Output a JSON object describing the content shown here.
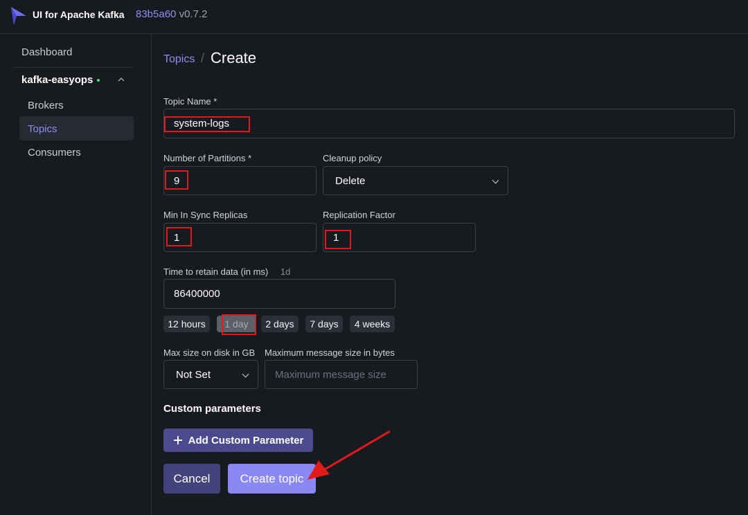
{
  "header": {
    "brand": "UI for Apache Kafka",
    "commit": "83b5a60",
    "version": "v0.7.2"
  },
  "sidebar": {
    "dashboard": "Dashboard",
    "cluster": "kafka-easyops",
    "items": [
      {
        "label": "Brokers"
      },
      {
        "label": "Topics",
        "active": true
      },
      {
        "label": "Consumers"
      }
    ]
  },
  "breadcrumb": {
    "parent": "Topics",
    "separator": "/",
    "current": "Create"
  },
  "form": {
    "topic_name": {
      "label": "Topic Name *",
      "value": "system-logs"
    },
    "partitions": {
      "label": "Number of Partitions *",
      "value": "9"
    },
    "cleanup_policy": {
      "label": "Cleanup policy",
      "value": "Delete"
    },
    "min_isr": {
      "label": "Min In Sync Replicas",
      "value": "1"
    },
    "replication_factor": {
      "label": "Replication Factor",
      "value": "1"
    },
    "retention": {
      "label": "Time to retain data (in ms)",
      "hint": "1d",
      "value": "86400000",
      "presets": [
        "12 hours",
        "1 day",
        "2 days",
        "7 days",
        "4 weeks"
      ],
      "selected": "1 day"
    },
    "max_disk": {
      "label": "Max size on disk in GB",
      "value": "Not Set"
    },
    "max_message": {
      "label": "Maximum message size in bytes",
      "placeholder": "Maximum message size"
    },
    "custom_params": {
      "title": "Custom parameters",
      "add_label": "Add Custom Parameter"
    },
    "actions": {
      "cancel": "Cancel",
      "create": "Create topic"
    }
  },
  "colors": {
    "accent": "#8b87f3",
    "background": "#171a1f",
    "annotation": "#e11b1b"
  }
}
